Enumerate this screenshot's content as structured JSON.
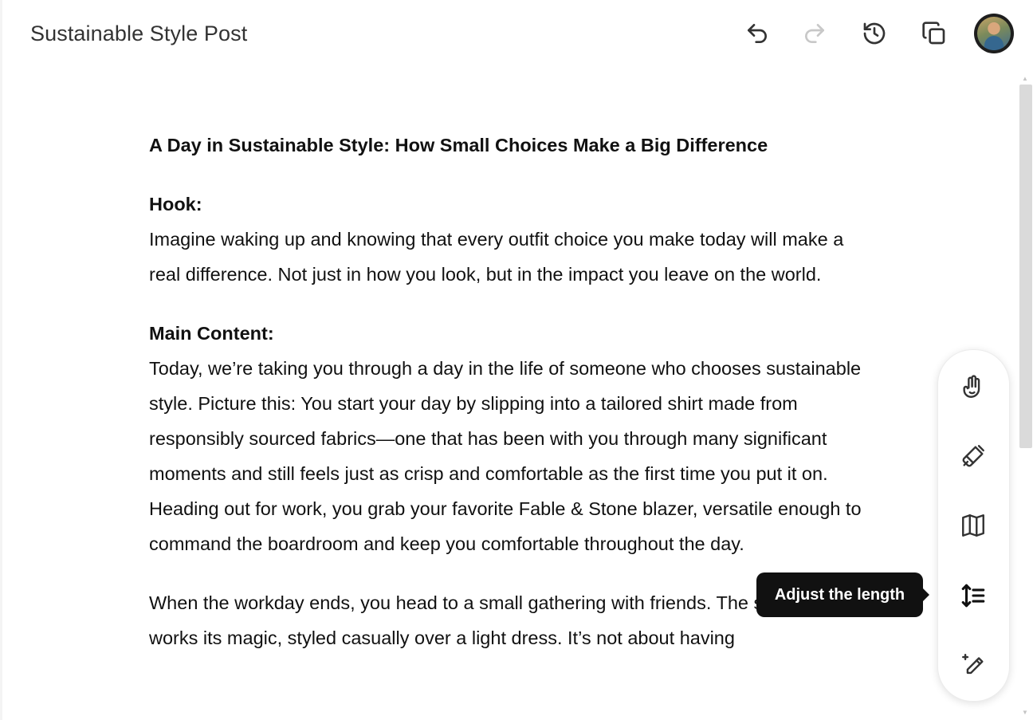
{
  "header": {
    "title": "Sustainable Style Post",
    "icons": [
      "undo-icon",
      "redo-icon",
      "history-icon",
      "copy-icon",
      "user-avatar"
    ]
  },
  "article": {
    "title": "A Day in Sustainable Style: How Small Choices Make a Big Difference",
    "hook_label": "Hook:",
    "hook_text": "Imagine waking up and knowing that every outfit choice you make today will make a real difference. Not just in how you look, but in the impact you leave on the world.",
    "main_label": "Main Content:",
    "main_text": "Today, we’re taking you through a day in the life of someone who chooses sustainable style. Picture this: You start your day by slipping into a tailored shirt made from responsibly sourced fabrics—one that has been with you through many significant moments and still feels just as crisp and comfortable as the first time you put it on. Heading out for work, you grab your favorite Fable & Stone blazer, versatile enough to command the boardroom and keep you comfortable throughout the day.",
    "para3": "When the workday ends, you head to a small gathering with friends. The same blazer works its magic, styled casually over a light dress. It’s not about having"
  },
  "toolbar": {
    "tools": [
      "emoji-icon",
      "polish-icon",
      "reading-level-icon",
      "adjust-length-icon",
      "edit-sparkle-icon"
    ]
  },
  "tooltip": {
    "text": "Adjust the length"
  },
  "colors": {
    "tooltip_bg": "#111111",
    "text": "#111111",
    "icon": "#333333"
  }
}
